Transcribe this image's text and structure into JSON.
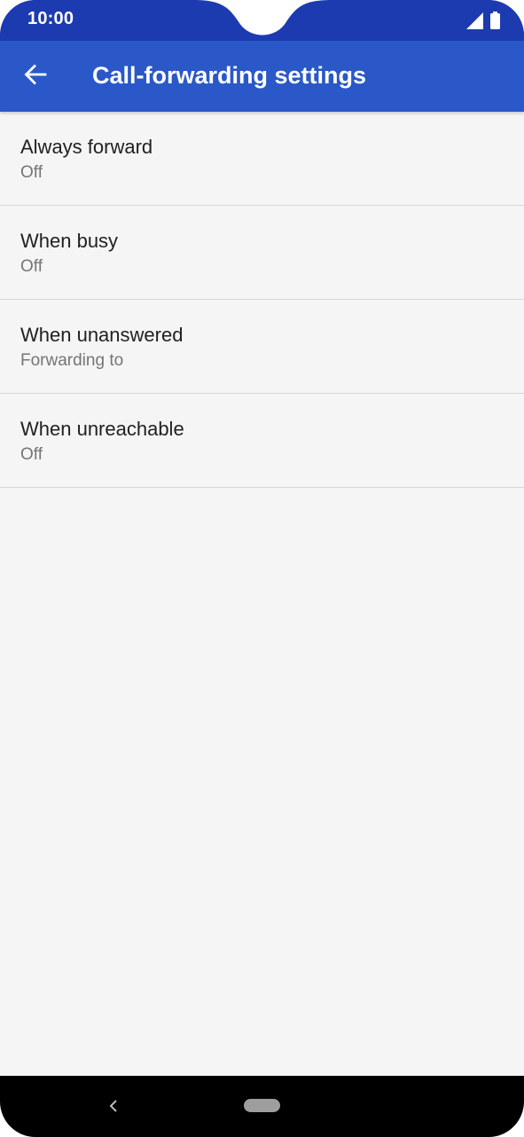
{
  "status_bar": {
    "time": "10:00",
    "icons": [
      "signal-icon",
      "battery-icon"
    ]
  },
  "app_bar": {
    "back_icon": "arrow-left-icon",
    "title": "Call-forwarding settings"
  },
  "settings": {
    "items": [
      {
        "title": "Always forward",
        "summary": "Off"
      },
      {
        "title": "When busy",
        "summary": "Off"
      },
      {
        "title": "When unanswered",
        "summary": "Forwarding to"
      },
      {
        "title": "When unreachable",
        "summary": "Off"
      }
    ]
  },
  "nav_bar": {
    "back_icon": "nav-back-icon",
    "home_icon": "home-pill-icon"
  },
  "colors": {
    "status_bar": "#1d3bb0",
    "app_bar": "#2a58c8",
    "background": "#f5f5f5",
    "divider": "#d6d6d6"
  }
}
